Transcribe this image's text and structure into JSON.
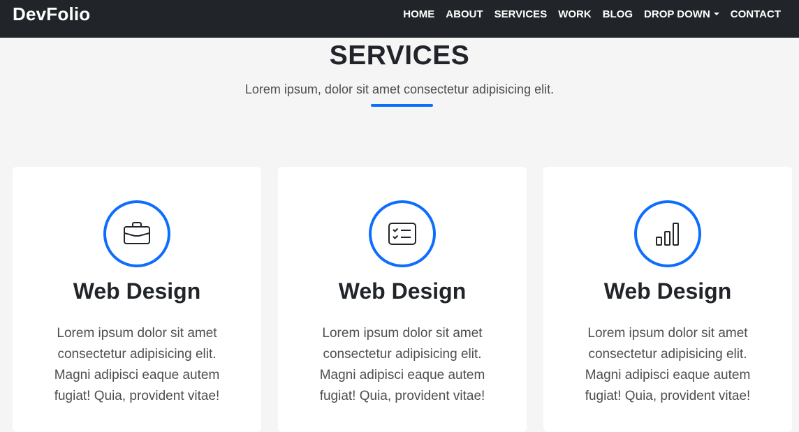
{
  "navbar": {
    "brand": "DevFolio",
    "links": [
      "HOME",
      "ABOUT",
      "SERVICES",
      "WORK",
      "BLOG",
      "DROP DOWN",
      "CONTACT"
    ]
  },
  "section": {
    "title": "SERVICES",
    "subtitle": "Lorem ipsum, dolor sit amet consectetur adipisicing elit."
  },
  "cards": [
    {
      "icon": "briefcase-icon",
      "title": "Web Design",
      "text": "Lorem ipsum dolor sit amet consectetur adipisicing elit. Magni adipisci eaque autem fugiat! Quia, provident vitae!"
    },
    {
      "icon": "card-checklist-icon",
      "title": "Web Design",
      "text": "Lorem ipsum dolor sit amet consectetur adipisicing elit. Magni adipisci eaque autem fugiat! Quia, provident vitae!"
    },
    {
      "icon": "bar-chart-icon",
      "title": "Web Design",
      "text": "Lorem ipsum dolor sit amet consectetur adipisicing elit. Magni adipisci eaque autem fugiat! Quia, provident vitae!"
    }
  ],
  "colors": {
    "navbar_bg": "#212529",
    "accent": "#0d6efd",
    "page_bg": "#f5f5f5"
  }
}
